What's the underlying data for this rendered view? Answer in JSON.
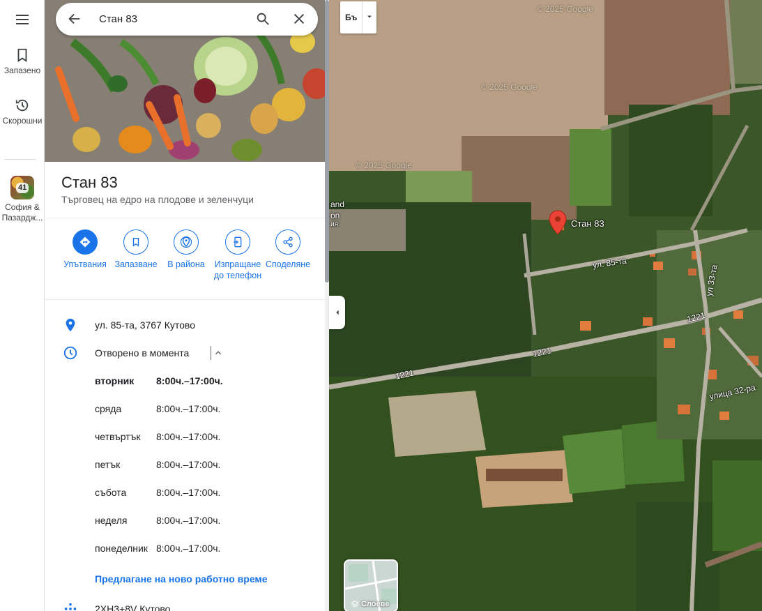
{
  "search": {
    "value": "Стан 83"
  },
  "rail": {
    "saved_label": "Запазено",
    "recent_label": "Скорошни",
    "recent_item_label": "София & Пазардж...",
    "recent_item_badge": "41"
  },
  "place": {
    "name": "Стан 83",
    "category": "Търговец на едро на плодове и зеленчуци"
  },
  "actions": [
    {
      "label": "Упътвания"
    },
    {
      "label": "Запазване"
    },
    {
      "label": "В района"
    },
    {
      "label": "Изпращане до телефон"
    },
    {
      "label": "Споделяне"
    }
  ],
  "info": {
    "address": "ул. 85-та, 3767 Кутово",
    "open_status": "Отворено в момента",
    "hours": [
      {
        "day": "вторник",
        "time": "8:00ч.–17:00ч.",
        "today": true
      },
      {
        "day": "сряда",
        "time": "8:00ч.–17:00ч."
      },
      {
        "day": "четвъртък",
        "time": "8:00ч.–17:00ч."
      },
      {
        "day": "петък",
        "time": "8:00ч.–17:00ч."
      },
      {
        "day": "събота",
        "time": "8:00ч.–17:00ч."
      },
      {
        "day": "неделя",
        "time": "8:00ч.–17:00ч."
      },
      {
        "day": "понеделник",
        "time": "8:00ч.–17:00ч."
      }
    ],
    "suggest_hours": "Предлагане на ново работно време",
    "plus_code": "2XH3+8V Кутово"
  },
  "map": {
    "language_button": "Бъ",
    "layers_label": "Слоеве",
    "pin_label": "Стан 83",
    "street_labels": {
      "s85": "ул. 85-та",
      "s33": "ул 33-та",
      "r1221a": "1221",
      "r1221b": "1221",
      "r1221c": "1221",
      "s32": "улица 32-ра",
      "partial1": "and",
      "partial2": "on",
      "partial3": "ия"
    },
    "watermarks": [
      "© 2025 Google",
      "© 2025 Google",
      "© 2025 Google"
    ],
    "colors": {
      "pin": "#ea4335",
      "accent": "#1a73e8"
    }
  }
}
